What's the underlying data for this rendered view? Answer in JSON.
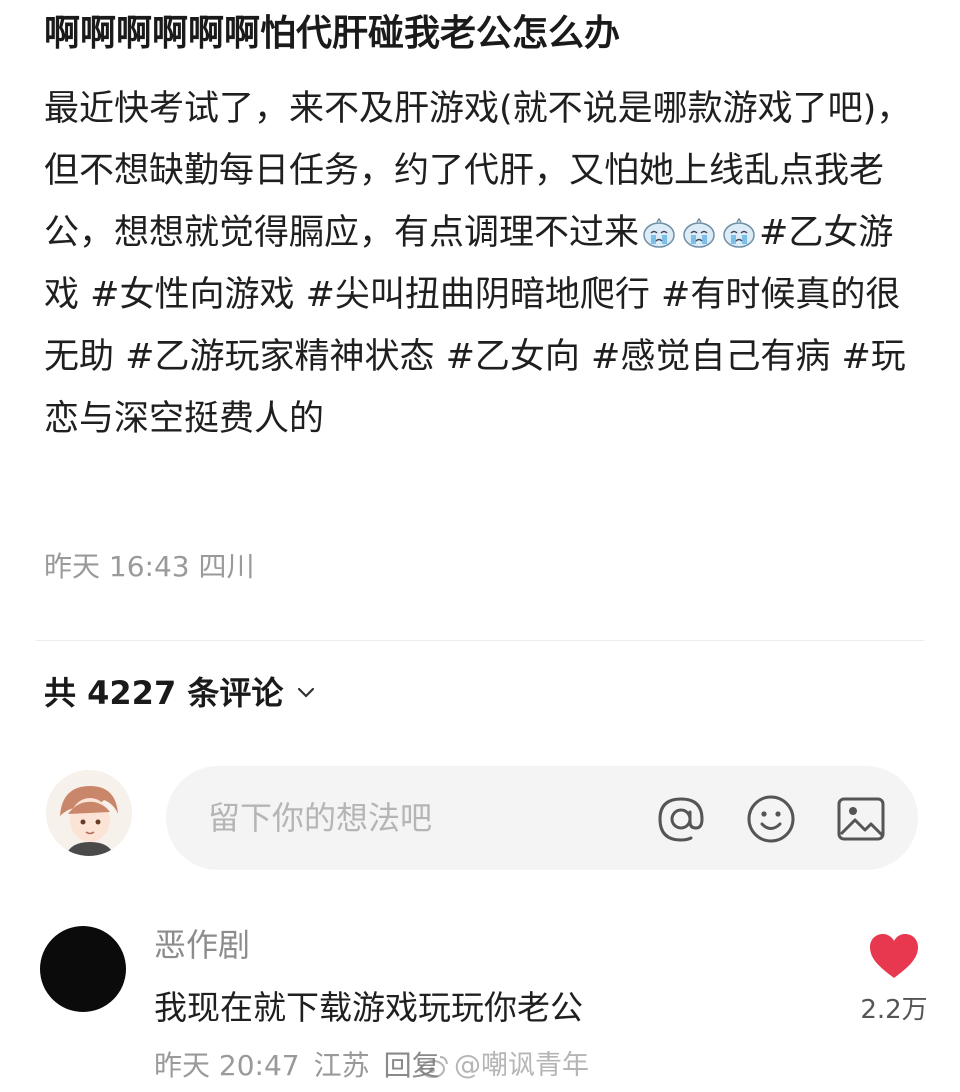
{
  "post": {
    "title": "啊啊啊啊啊啊怕代肝碰我老公怎么办",
    "body_part1": "最近快考试了，来不及肝游戏(就不说是哪款游戏了吧)，但不想缺勤每日任务，约了代肝，又怕她上线乱点我老公，想想就觉得膈应，有点调理不过来",
    "emoji": "crying-face-emoji",
    "body_part2": "#乙女游戏 #女性向游戏 #尖叫扭曲阴暗地爬行 #有时候真的很无助 #乙游玩家精神状态 #乙女向 #感觉自己有病 #玩恋与深空挺费人的",
    "meta": "昨天 16:43 四川"
  },
  "comments": {
    "count_label": "共 4227 条评论",
    "input_placeholder": "留下你的想法吧",
    "icons": [
      "at-icon",
      "emoji-icon",
      "image-icon"
    ],
    "items": [
      {
        "user": "恶作剧",
        "text": "我现在就下载游戏玩玩你老公",
        "time": "昨天 20:47",
        "location": "江苏",
        "reply_label": "回复",
        "likes": "2.2万"
      }
    ]
  },
  "watermark": "@嘲讽青年",
  "colors": {
    "like_red": "#e8384f",
    "meta_gray": "#9a9a9a",
    "input_bg": "#f4f4f5"
  }
}
